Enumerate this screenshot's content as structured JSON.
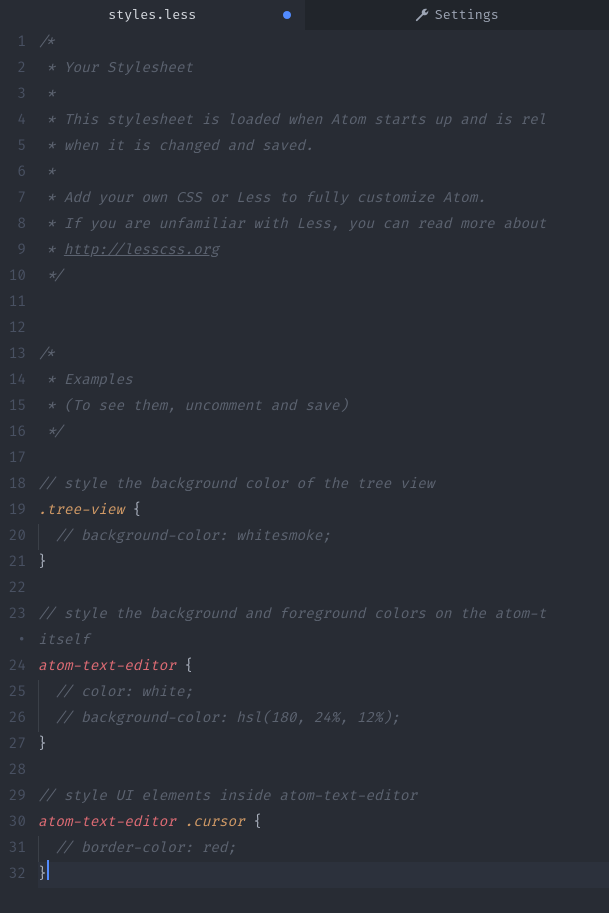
{
  "tabs": {
    "active": {
      "label": "styles.less",
      "modified": true
    },
    "settings": {
      "label": "Settings"
    }
  },
  "code": {
    "lines": [
      {
        "n": "1",
        "tokens": [
          {
            "t": "comment",
            "v": "/*"
          }
        ]
      },
      {
        "n": "2",
        "tokens": [
          {
            "t": "comment",
            "v": " * Your Stylesheet"
          }
        ]
      },
      {
        "n": "3",
        "tokens": [
          {
            "t": "comment",
            "v": " *"
          }
        ]
      },
      {
        "n": "4",
        "tokens": [
          {
            "t": "comment",
            "v": " * This stylesheet is loaded when Atom starts up and is rel"
          }
        ]
      },
      {
        "n": "5",
        "tokens": [
          {
            "t": "comment",
            "v": " * when it is changed and saved."
          }
        ]
      },
      {
        "n": "6",
        "tokens": [
          {
            "t": "comment",
            "v": " *"
          }
        ]
      },
      {
        "n": "7",
        "tokens": [
          {
            "t": "comment",
            "v": " * Add your own CSS or Less to fully customize Atom."
          }
        ]
      },
      {
        "n": "8",
        "tokens": [
          {
            "t": "comment",
            "v": " * If you are unfamiliar with Less, you can read more about"
          }
        ]
      },
      {
        "n": "9",
        "tokens": [
          {
            "t": "comment",
            "v": " * "
          },
          {
            "t": "comment-link",
            "v": "http://lesscss.org"
          }
        ]
      },
      {
        "n": "10",
        "tokens": [
          {
            "t": "comment",
            "v": " */"
          }
        ]
      },
      {
        "n": "11",
        "tokens": []
      },
      {
        "n": "12",
        "tokens": []
      },
      {
        "n": "13",
        "tokens": [
          {
            "t": "comment",
            "v": "/*"
          }
        ]
      },
      {
        "n": "14",
        "tokens": [
          {
            "t": "comment",
            "v": " * Examples"
          }
        ]
      },
      {
        "n": "15",
        "tokens": [
          {
            "t": "comment",
            "v": " * (To see them, uncomment and save)"
          }
        ]
      },
      {
        "n": "16",
        "tokens": [
          {
            "t": "comment",
            "v": " */"
          }
        ]
      },
      {
        "n": "17",
        "tokens": []
      },
      {
        "n": "18",
        "tokens": [
          {
            "t": "comment",
            "v": "// style the background color of the tree view"
          }
        ]
      },
      {
        "n": "19",
        "tokens": [
          {
            "t": "selector-class",
            "v": ".tree-view"
          },
          {
            "t": "brace",
            "v": " {"
          }
        ]
      },
      {
        "n": "20",
        "tokens": [
          {
            "t": "indent",
            "v": "  "
          },
          {
            "t": "comment",
            "v": "// background-color: whitesmoke;"
          }
        ]
      },
      {
        "n": "21",
        "tokens": [
          {
            "t": "brace",
            "v": "}"
          }
        ]
      },
      {
        "n": "22",
        "tokens": []
      },
      {
        "n": "23",
        "tokens": [
          {
            "t": "comment",
            "v": "// style the background and foreground colors on the atom-t"
          }
        ]
      },
      {
        "n": "·",
        "tokens": [
          {
            "t": "comment",
            "v": "itself"
          }
        ],
        "soft": true
      },
      {
        "n": "24",
        "tokens": [
          {
            "t": "selector-tag",
            "v": "atom-text-editor"
          },
          {
            "t": "brace",
            "v": " {"
          }
        ]
      },
      {
        "n": "25",
        "tokens": [
          {
            "t": "indent",
            "v": "  "
          },
          {
            "t": "comment",
            "v": "// color: white;"
          }
        ]
      },
      {
        "n": "26",
        "tokens": [
          {
            "t": "indent",
            "v": "  "
          },
          {
            "t": "comment",
            "v": "// background-color: hsl(180, 24%, 12%);"
          }
        ]
      },
      {
        "n": "27",
        "tokens": [
          {
            "t": "brace",
            "v": "}"
          }
        ]
      },
      {
        "n": "28",
        "tokens": []
      },
      {
        "n": "29",
        "tokens": [
          {
            "t": "comment",
            "v": "// style UI elements inside atom-text-editor"
          }
        ]
      },
      {
        "n": "30",
        "tokens": [
          {
            "t": "selector-tag",
            "v": "atom-text-editor"
          },
          {
            "t": "selector-class",
            "v": " .cursor"
          },
          {
            "t": "brace",
            "v": " {"
          }
        ]
      },
      {
        "n": "31",
        "tokens": [
          {
            "t": "indent",
            "v": "  "
          },
          {
            "t": "comment",
            "v": "// border-color: red;"
          }
        ]
      },
      {
        "n": "32",
        "tokens": [
          {
            "t": "brace",
            "v": "}"
          },
          {
            "t": "cursor",
            "v": ""
          }
        ],
        "cursor": true
      }
    ]
  }
}
